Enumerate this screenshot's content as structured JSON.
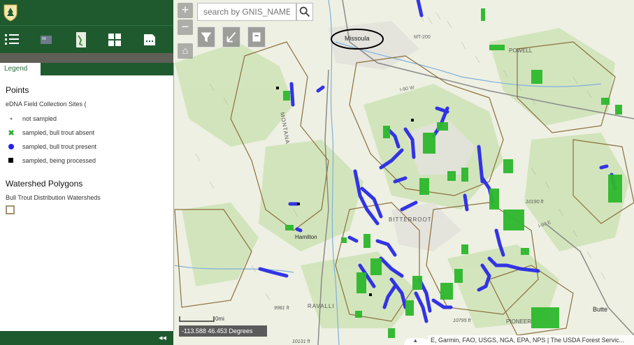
{
  "search": {
    "placeholder": "search by GNIS_NAME"
  },
  "legend": {
    "tab_label": "Legend",
    "points_title": "Points",
    "layer_name": "eDNA Field Collection Sites (",
    "items": [
      {
        "label": "not sampled",
        "symbol": "small-dot-icon",
        "color": "#888888"
      },
      {
        "label": "sampled, bull trout absent",
        "symbol": "green-x-icon",
        "color": "#22aa22"
      },
      {
        "label": "sampled, bull trout present",
        "symbol": "blue-dot-icon",
        "color": "#2222ee"
      },
      {
        "label": "sampled, being processed",
        "symbol": "black-square-icon",
        "color": "#000000"
      }
    ],
    "polygons_title": "Watershed Polygons",
    "polygon_layer": "Bull Trout Distribution Watersheds",
    "polygon_color": "#8b6f3d"
  },
  "map": {
    "labels": {
      "missoula": "Missoula",
      "powell": "POWELL",
      "hamilton": "Hamilton",
      "ravalli": "RAVALLI",
      "montana": "MONTANA",
      "pioneer": "PIONEER",
      "butte": "Butte",
      "bitterroot": "BITTERROOT",
      "elev1": "10190 ft",
      "elev2": "9981 ft",
      "elev3": "10795 ft",
      "elev4": "10131 ft",
      "hwy": "I-90 E",
      "hwy2": "I-90 W",
      "mt200": "MT-200"
    },
    "coordinates": "-113.588 46.453 Degrees",
    "scale_label": "0mi",
    "attribution": "E, Garmin, FAO, USGS, NGA, EPA, NPS | The USDA Forest Servic..."
  },
  "colors": {
    "header_green": "#1f5a2f",
    "present_blue": "#2222ee",
    "absent_green": "#22aa22"
  }
}
